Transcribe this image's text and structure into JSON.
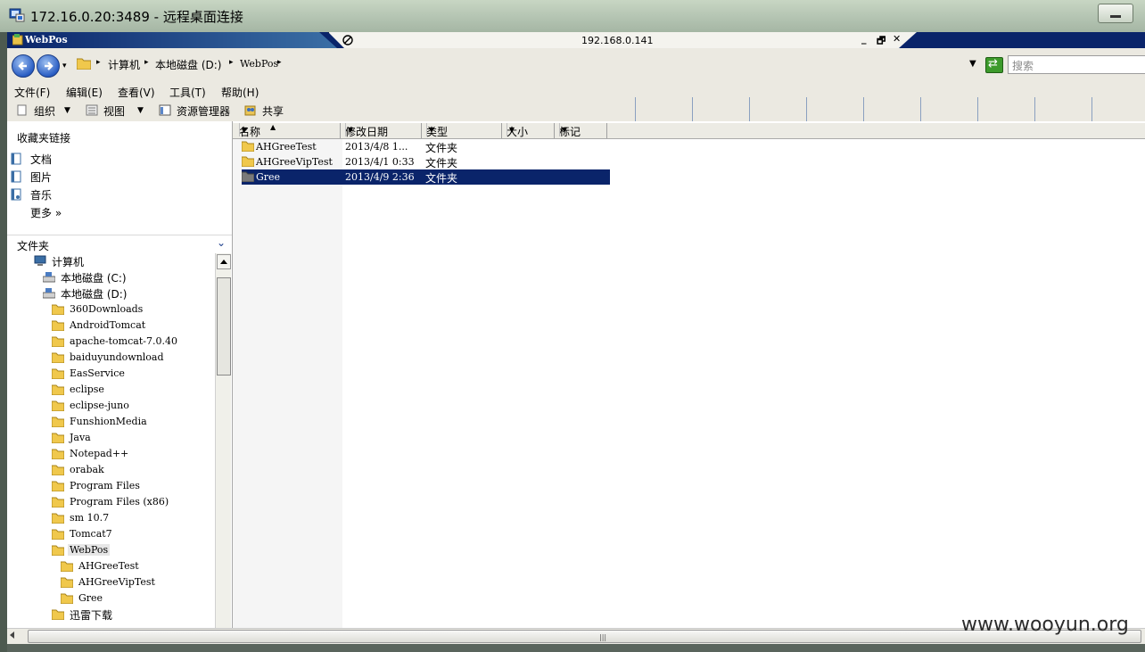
{
  "rdp": {
    "title": "172.16.0.20:3489 - 远程桌面连接"
  },
  "inner_window": {
    "title": "WebPos",
    "connection_address": "192.168.0.141",
    "minimize_glyph": "_",
    "restore_glyph": "🗗",
    "close_glyph": "✕"
  },
  "address_bar": {
    "breadcrumb": [
      "计算机",
      "本地磁盘 (D:)",
      "WebPos"
    ],
    "search_placeholder": "搜索"
  },
  "menu": [
    "文件(F)",
    "编辑(E)",
    "查看(V)",
    "工具(T)",
    "帮助(H)"
  ],
  "toolbar": {
    "organize": "组织",
    "view": "视图",
    "explorer": "资源管理器",
    "share": "共享"
  },
  "favorites": {
    "header": "收藏夹链接",
    "items": [
      {
        "label": "文档",
        "icon": "documents-icon"
      },
      {
        "label": "图片",
        "icon": "pictures-icon"
      },
      {
        "label": "音乐",
        "icon": "music-icon"
      },
      {
        "label": "更多  »",
        "icon": ""
      }
    ]
  },
  "folders_pane": {
    "header": "文件夹",
    "tree": [
      {
        "label": "计算机",
        "kind": "computer"
      },
      {
        "label": "本地磁盘 (C:)",
        "kind": "drive"
      },
      {
        "label": "本地磁盘 (D:)",
        "kind": "drive"
      },
      {
        "label": "360Downloads",
        "kind": "folder"
      },
      {
        "label": "AndroidTomcat",
        "kind": "folder"
      },
      {
        "label": "apache-tomcat-7.0.40",
        "kind": "folder"
      },
      {
        "label": "baiduyundownload",
        "kind": "folder"
      },
      {
        "label": "EasService",
        "kind": "folder"
      },
      {
        "label": "eclipse",
        "kind": "folder"
      },
      {
        "label": "eclipse-juno",
        "kind": "folder"
      },
      {
        "label": "FunshionMedia",
        "kind": "folder"
      },
      {
        "label": "Java",
        "kind": "folder"
      },
      {
        "label": "Notepad++",
        "kind": "folder"
      },
      {
        "label": "orabak",
        "kind": "folder"
      },
      {
        "label": "Program Files",
        "kind": "folder"
      },
      {
        "label": "Program Files (x86)",
        "kind": "folder"
      },
      {
        "label": "sm 10.7",
        "kind": "folder"
      },
      {
        "label": "Tomcat7",
        "kind": "folder"
      },
      {
        "label": "WebPos",
        "kind": "folder",
        "selected": true
      },
      {
        "label": "AHGreeTest",
        "kind": "folder"
      },
      {
        "label": "AHGreeVipTest",
        "kind": "folder"
      },
      {
        "label": "Gree",
        "kind": "folder"
      },
      {
        "label": "迅雷下载",
        "kind": "folder"
      }
    ]
  },
  "file_list": {
    "columns": [
      "名称",
      "修改日期",
      "类型",
      "大小",
      "标记"
    ],
    "rows": [
      {
        "name": "AHGreeTest",
        "date": "2013/4/8 1...",
        "type": "文件夹"
      },
      {
        "name": "AHGreeVipTest",
        "date": "2013/4/1 0:33",
        "type": "文件夹"
      },
      {
        "name": "Gree",
        "date": "2013/4/9 2:36",
        "type": "文件夹",
        "selected": true
      }
    ]
  },
  "watermark": "www.wooyun.org",
  "colors": {
    "selection": "#0a246a",
    "inner_title": "#0a246a",
    "chrome": "#ebe9e1"
  }
}
